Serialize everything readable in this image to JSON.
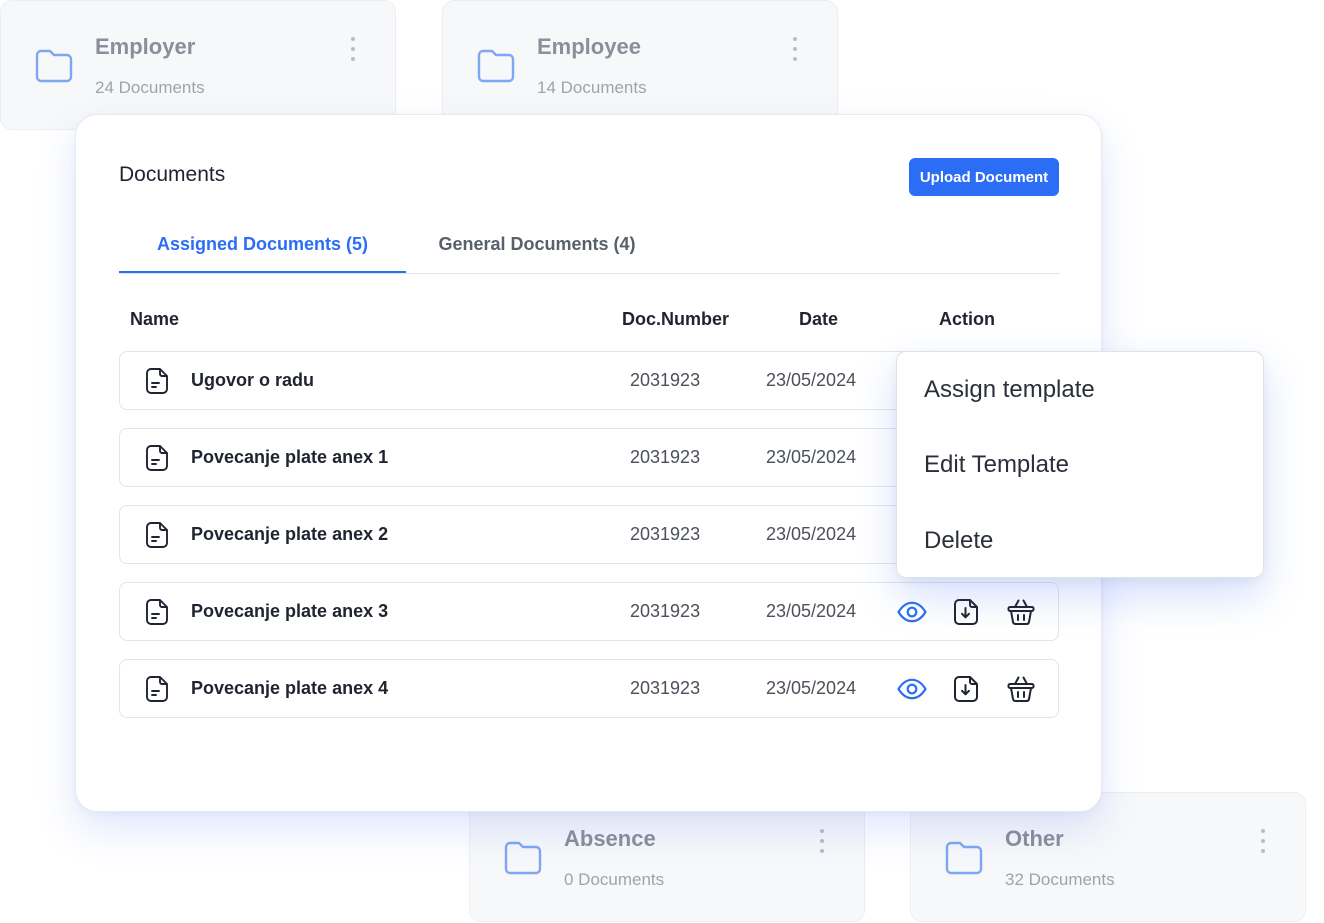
{
  "folders": [
    {
      "title": "Employer",
      "count": "24 Documents"
    },
    {
      "title": "Employee",
      "count": "14 Documents"
    },
    {
      "title": "Absence",
      "count": "0 Documents"
    },
    {
      "title": "Other",
      "count": "32 Documents"
    }
  ],
  "panel": {
    "title": "Documents",
    "upload_label": "Upload Document",
    "tabs": [
      {
        "label": "Assigned Documents (5)",
        "active": true
      },
      {
        "label": "General Documents (4)",
        "active": false
      }
    ],
    "columns": {
      "name": "Name",
      "doc_number": "Doc.Number",
      "date": "Date",
      "action": "Action"
    },
    "rows": [
      {
        "name": "Ugovor o radu",
        "doc_number": "2031923",
        "date": "23/05/2024"
      },
      {
        "name": "Povecanje plate anex 1",
        "doc_number": "2031923",
        "date": "23/05/2024"
      },
      {
        "name": "Povecanje plate anex 2",
        "doc_number": "2031923",
        "date": "23/05/2024"
      },
      {
        "name": "Povecanje plate anex 3",
        "doc_number": "2031923",
        "date": "23/05/2024"
      },
      {
        "name": "Povecanje plate anex 4",
        "doc_number": "2031923",
        "date": "23/05/2024"
      }
    ]
  },
  "dropdown": {
    "items": [
      "Assign template",
      "Edit Template",
      "Delete"
    ]
  },
  "icons": {
    "folder": "folder-icon",
    "more": "more-vertical-icon",
    "document": "document-icon",
    "view": "eye-icon",
    "download": "download-icon",
    "delete": "trash-icon"
  },
  "colors": {
    "accent": "#2b6ef5",
    "folder_icon": "#7fa6f2"
  }
}
